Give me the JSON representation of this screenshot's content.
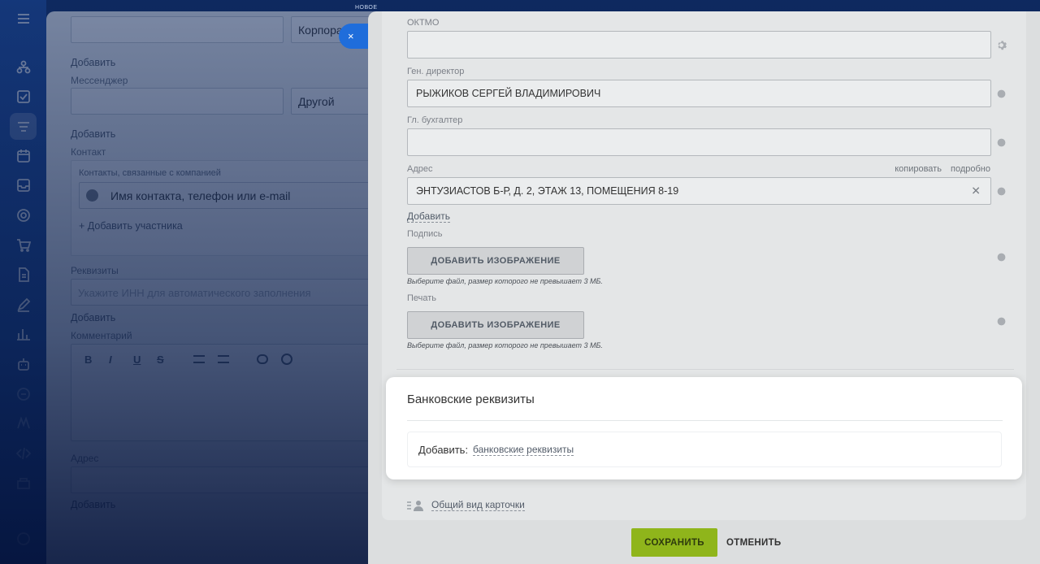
{
  "nav": {
    "icons": [
      "menu-icon",
      "sitemap-icon",
      "tasks-icon",
      "crm-funnel-icon",
      "calendar-icon",
      "inbox-icon",
      "target-icon",
      "cart-icon",
      "document-icon",
      "sign-icon",
      "analytics-icon",
      "robot-icon",
      "support-icon",
      "sites-icon",
      "code-icon",
      "marketplace-icon",
      "help-icon"
    ],
    "new_tag": "НОВОЕ"
  },
  "background_form": {
    "phone_type": "Корпора",
    "add_label_1": "Добавить",
    "messenger_label": "Мессенджер",
    "messenger_type": "Другой",
    "add_label_2": "Добавить",
    "contact_label": "Контакт",
    "contacts_related": "Контакты, связанные с компанией",
    "contact_placeholder": "Имя контакта, телефон или e-mail",
    "add_participant": "+ Добавить участника",
    "requisites_label": "Реквизиты",
    "requisites_placeholder": "Укажите ИНН для автоматического заполнения",
    "add_label_3": "Добавить",
    "comment_label": "Комментарий",
    "rte_bold": "B",
    "rte_italic": "I",
    "rte_underline": "U",
    "rte_strike": "S",
    "address_label": "Адрес",
    "add_label_4": "Добавить"
  },
  "panel": {
    "close_symbol": "×",
    "fields": {
      "oktmo_label": "ОКТМО",
      "oktmo_value": "",
      "director_label": "Ген. директор",
      "director_value": "РЫЖИКОВ СЕРГЕЙ ВЛАДИМИРОВИЧ",
      "accountant_label": "Гл. бухгалтер",
      "accountant_value": "",
      "address_label": "Адрес",
      "address_copy": "копировать",
      "address_details": "подробно",
      "address_value": "ЭНТУЗИАСТОВ Б-Р, Д. 2, ЭТАЖ 13, ПОМЕЩЕНИЯ 8-19",
      "address_clear": "✕",
      "add_link": "Добавить",
      "signature_label": "Подпись",
      "signature_button": "ДОБАВИТЬ ИЗОБРАЖЕНИЕ",
      "signature_hint": "Выберите файл, размер которого не превышает 3 МБ.",
      "stamp_label": "Печать",
      "stamp_button": "ДОБАВИТЬ ИЗОБРАЖЕНИЕ",
      "stamp_hint": "Выберите файл, размер которого не превышает 3 МБ."
    },
    "bank": {
      "title": "Банковские реквизиты",
      "add_label": "Добавить:",
      "add_link": "банковские реквизиты"
    },
    "general_view": "Общий вид карточки",
    "footer": {
      "save": "СОХРАНИТЬ",
      "cancel": "ОТМЕНИТЬ"
    }
  },
  "colors": {
    "save_button": "#8fb51b",
    "close_button": "#1f6ddb",
    "nav_background": "#1a4aa0"
  }
}
